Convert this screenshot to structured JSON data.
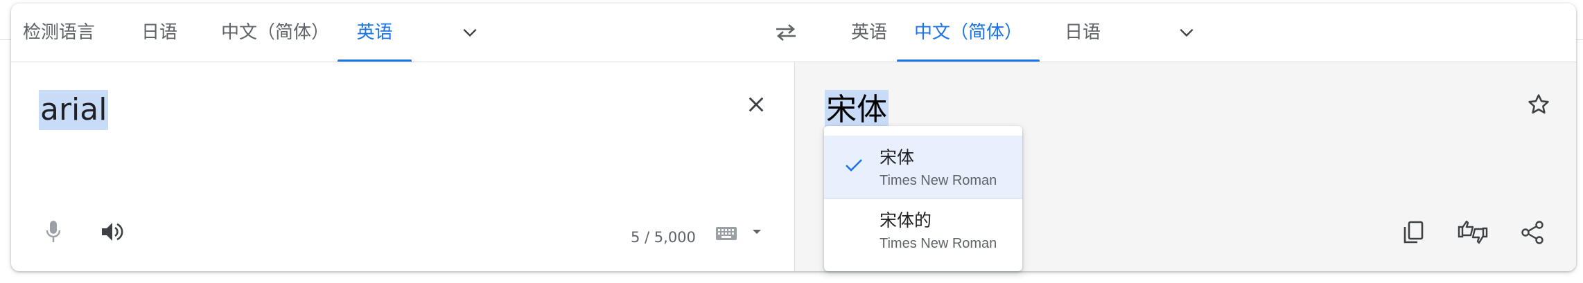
{
  "source_tabs": [
    {
      "label": "检测语言",
      "active": false
    },
    {
      "label": "日语",
      "active": false
    },
    {
      "label": "中文（简体）",
      "active": false
    },
    {
      "label": "英语",
      "active": true
    }
  ],
  "target_tabs": [
    {
      "label": "英语",
      "active": false
    },
    {
      "label": "中文（简体）",
      "active": true
    },
    {
      "label": "日语",
      "active": false
    }
  ],
  "source": {
    "text": "arial",
    "char_count": "5 / 5,000"
  },
  "target": {
    "text": "宋体"
  },
  "alternatives": [
    {
      "text": "宋体",
      "subtext": "Times New Roman",
      "selected": true
    },
    {
      "text": "宋体的",
      "subtext": "Times New Roman",
      "selected": false
    }
  ],
  "colors": {
    "accent": "#1a73e8",
    "icon": "#5f6368",
    "selection_highlight": "#c9dcf7",
    "menu_selected_bg": "#e8f0fe",
    "target_bg": "#f5f5f5"
  },
  "icons": {
    "source_more": "chevron-down-icon",
    "swap": "swap-languages-icon",
    "target_more": "chevron-down-icon",
    "clear": "close-icon",
    "mic": "microphone-icon",
    "listen": "speaker-icon",
    "keyboard": "keyboard-icon",
    "star": "star-icon",
    "copy": "copy-icon",
    "feedback": "thumbs-feedback-icon",
    "share": "share-icon",
    "check": "check-icon"
  }
}
